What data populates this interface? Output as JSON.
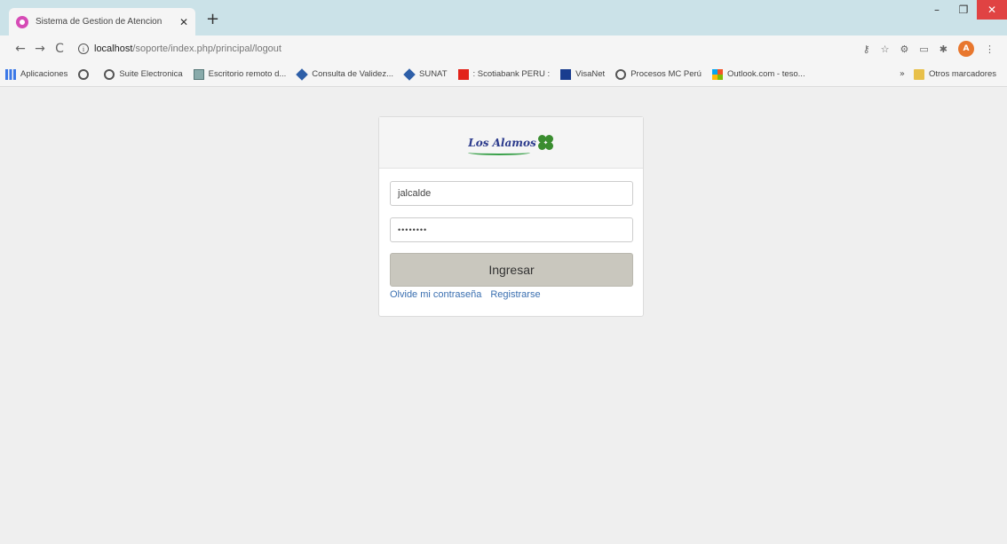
{
  "browser": {
    "tab": {
      "title": "Sistema de Gestion de Atencion",
      "close": "✕"
    },
    "new_tab": "+",
    "window_buttons": {
      "minimize": "–",
      "maximize": "❐",
      "close": "✕"
    },
    "url_host": "localhost",
    "url_path": "/soporte/index.php/principal/logout",
    "profile_initial": "A"
  },
  "bookmarks": [
    {
      "label": "Aplicaciones",
      "icon": "apps-icon"
    },
    {
      "label": "",
      "icon": "globe-icon"
    },
    {
      "label": "Suite Electronica",
      "icon": "globe-icon"
    },
    {
      "label": "Escritorio remoto d...",
      "icon": "remote-desktop-icon"
    },
    {
      "label": "Consulta de Validez...",
      "icon": "diamond-icon"
    },
    {
      "label": "SUNAT",
      "icon": "diamond-icon"
    },
    {
      "label": ": Scotiabank PERU :",
      "icon": "scotiabank-icon"
    },
    {
      "label": "VisaNet",
      "icon": "visanet-icon"
    },
    {
      "label": "Procesos MC Perú",
      "icon": "globe-icon"
    },
    {
      "label": "Outlook.com - teso...",
      "icon": "microsoft-icon"
    }
  ],
  "bookmarks_more": "»",
  "other_bookmarks": "Otros marcadores",
  "login": {
    "logo_text": "Los Alamos",
    "username": "jalcalde",
    "password_mask": "••••••••",
    "submit_label": "Ingresar",
    "forgot_link": "Olvide mi contraseña",
    "register_link": "Registrarse"
  }
}
